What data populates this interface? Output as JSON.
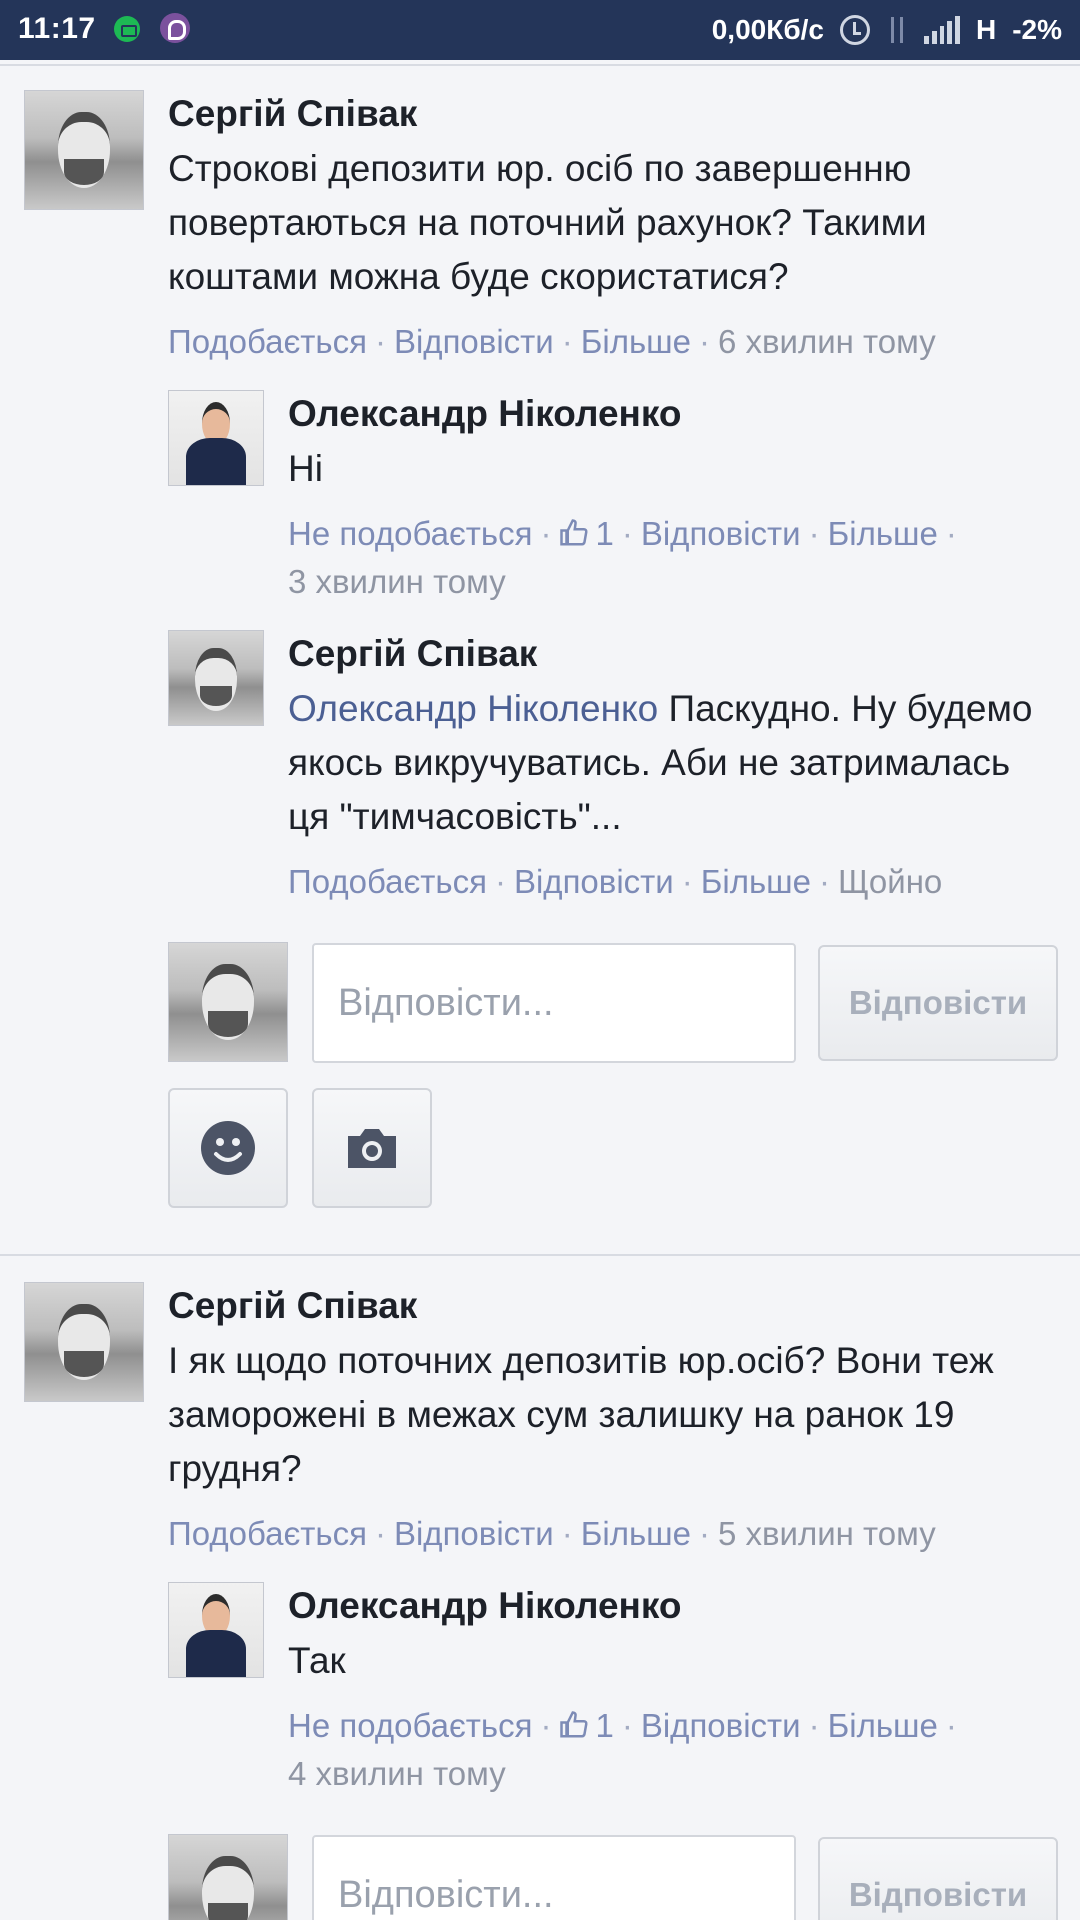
{
  "status_bar": {
    "time": "11:17",
    "speed": "0,00Кб/с",
    "network": "H",
    "battery": "-2%",
    "icons": [
      "app-icon",
      "viber-icon",
      "alarm-icon",
      "data-icon",
      "signal-icon"
    ]
  },
  "threads": [
    {
      "author": "Сергій Співак",
      "text": "Строкові депозити юр. осіб по завершенню повертаються на поточний рахунок? Такими коштами можна буде скористатися?",
      "actions": {
        "like": "Подобається",
        "reply": "Відповісти",
        "more": "Більше",
        "time": "6 хвилин тому"
      },
      "replies": [
        {
          "author": "Олександр Ніколенко",
          "text": "Ні",
          "actions": {
            "like": "Не подобається",
            "likes_count": "1",
            "reply": "Відповісти",
            "more": "Більше",
            "time": "3 хвилин тому"
          }
        },
        {
          "author": "Сергій Співак",
          "mention": "Олександр Ніколенко",
          "text": "Паскудно. Ну будемо якось викручуватись. Аби не затрималась ця \"тимчасовість\"...",
          "actions": {
            "like": "Подобається",
            "reply": "Відповісти",
            "more": "Більше",
            "time": "Щойно"
          }
        }
      ],
      "reply_box": {
        "placeholder": "Відповісти...",
        "button": "Відповісти"
      }
    },
    {
      "author": "Сергій Співак",
      "text": "І як щодо поточних депозитів юр.осіб? Вони теж заморожені в межах сум залишку на ранок 19 грудня?",
      "actions": {
        "like": "Подобається",
        "reply": "Відповісти",
        "more": "Більше",
        "time": "5 хвилин тому"
      },
      "replies": [
        {
          "author": "Олександр Ніколенко",
          "text": "Так",
          "actions": {
            "like": "Не подобається",
            "likes_count": "1",
            "reply": "Відповісти",
            "more": "Більше",
            "time": "4 хвилин тому"
          }
        }
      ],
      "reply_box": {
        "placeholder": "Відповісти...",
        "button": "Відповісти"
      }
    }
  ],
  "colors": {
    "status_bar": "#243559",
    "link": "#7d8bb6",
    "mention": "#4b5f93",
    "background": "#f4f5f8"
  }
}
